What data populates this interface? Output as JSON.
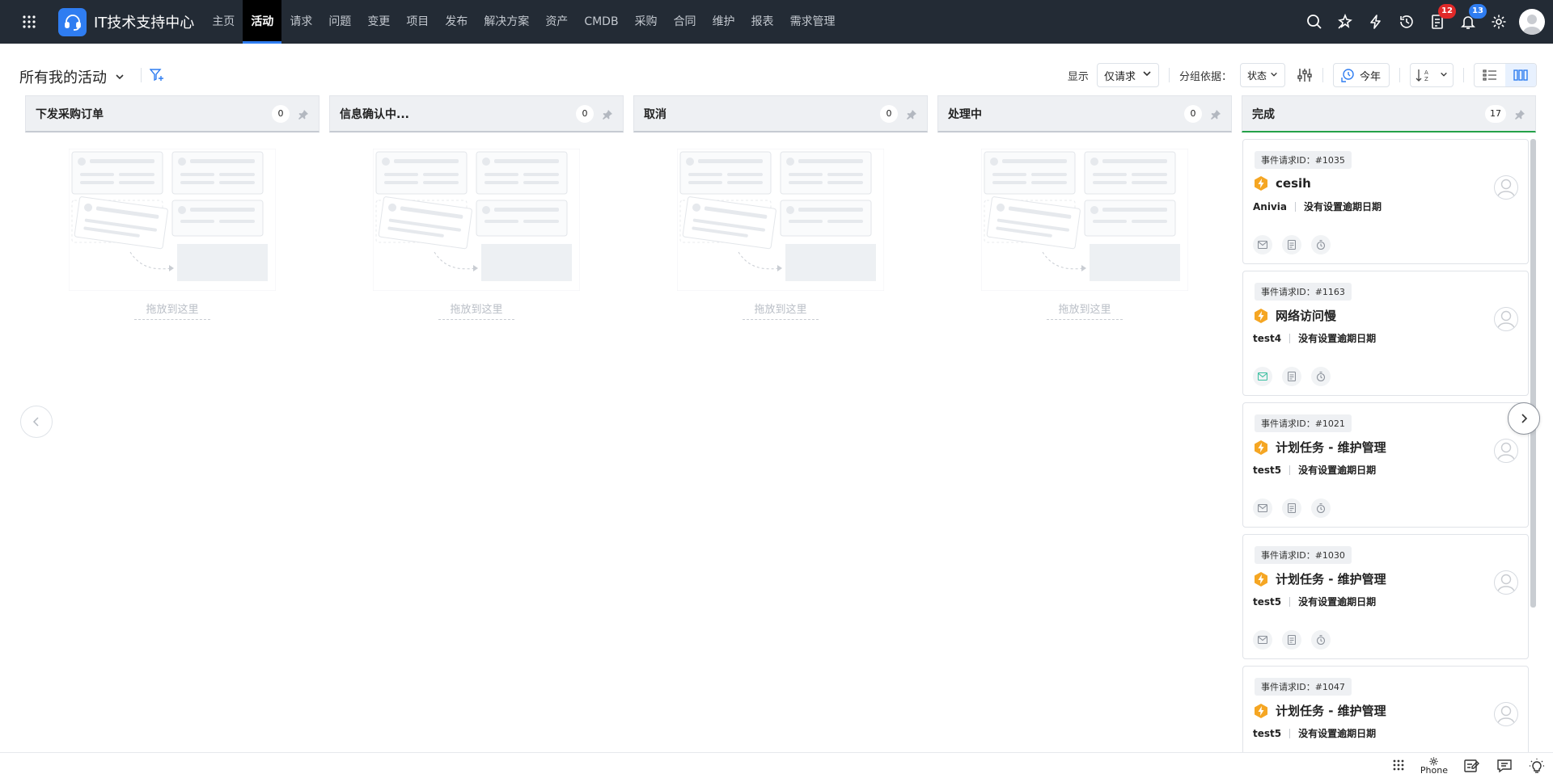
{
  "app": {
    "title": "IT技术支持中心"
  },
  "nav": {
    "tabs": [
      "主页",
      "活动",
      "请求",
      "问题",
      "变更",
      "项目",
      "发布",
      "解决方案",
      "资产",
      "CMDB",
      "采购",
      "合同",
      "维护",
      "报表",
      "需求管理"
    ],
    "active_index": 1,
    "badges": {
      "tasks": "12",
      "notifications": "13"
    }
  },
  "toolbar": {
    "view_title": "所有我的活动",
    "show_label": "显示",
    "show_value": "仅请求",
    "group_label": "分组依据：",
    "group_value": "状态",
    "date_value": "今年"
  },
  "board": {
    "drop_text": "拖放到这里",
    "columns": [
      {
        "title": "下发采购订单",
        "count": "0"
      },
      {
        "title": "信息确认中...",
        "count": "0"
      },
      {
        "title": "取消",
        "count": "0"
      },
      {
        "title": "处理中",
        "count": "0"
      },
      {
        "title": "完成",
        "count": "17"
      }
    ],
    "cards": [
      {
        "id": "事件请求ID：#1035",
        "title": "cesih",
        "requester": "Anivia",
        "due": "没有设置逾期日期",
        "mail_active": false
      },
      {
        "id": "事件请求ID：#1163",
        "title": "网络访问慢",
        "requester": "test4",
        "due": "没有设置逾期日期",
        "mail_active": true
      },
      {
        "id": "事件请求ID：#1021",
        "title": "计划任务 - 维护管理",
        "requester": "test5",
        "due": "没有设置逾期日期",
        "mail_active": false
      },
      {
        "id": "事件请求ID：#1030",
        "title": "计划任务 - 维护管理",
        "requester": "test5",
        "due": "没有设置逾期日期",
        "mail_active": false
      },
      {
        "id": "事件请求ID：#1047",
        "title": "计划任务 - 维护管理",
        "requester": "test5",
        "due": "没有设置逾期日期",
        "mail_active": false
      }
    ]
  },
  "bottombar": {
    "phone_label": "Phone"
  },
  "colors": {
    "nav_bg": "#232b35",
    "accent": "#2f7df1",
    "done": "#24a148",
    "priority": "#f5a623",
    "badge_red": "#e02929"
  }
}
